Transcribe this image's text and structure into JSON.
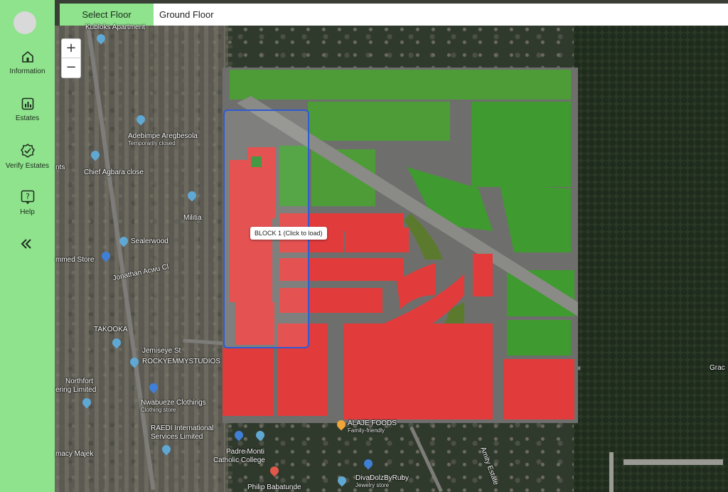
{
  "sidebar": {
    "items": [
      {
        "label": "Information",
        "icon": "home-icon"
      },
      {
        "label": "Estates",
        "icon": "chart-icon"
      },
      {
        "label": "Verify Estates",
        "icon": "verified-badge-icon"
      },
      {
        "label": "Help",
        "icon": "help-icon"
      }
    ],
    "collapse_icon": "double-chevron-left-icon"
  },
  "topbar": {
    "select_floor_label": "Select Floor",
    "floor_value": "Ground Floor"
  },
  "map": {
    "zoom_in": "+",
    "zoom_out": "−",
    "tooltip": "BLOCK 1 (Click to load)",
    "places": [
      {
        "name": "Kubloks Apartment",
        "sub": ""
      },
      {
        "name": "Adebimpe Aregbesola",
        "sub": "Temporarily closed"
      },
      {
        "name": "Chief Agbara close",
        "sub": ""
      },
      {
        "name": "Militia",
        "sub": ""
      },
      {
        "name": "Sealerwood",
        "sub": ""
      },
      {
        "name": "mmed Store",
        "sub": ""
      },
      {
        "name": "Jonathan Acwu Cl",
        "sub": ""
      },
      {
        "name": "TAKOOKA",
        "sub": ""
      },
      {
        "name": "Jemiseye St",
        "sub": ""
      },
      {
        "name": "ROCKYEMMYSTUDIOS",
        "sub": ""
      },
      {
        "name": "Northfort",
        "sub": ""
      },
      {
        "name": "ering Limited",
        "sub": ""
      },
      {
        "name": "Nwabueze Clothings",
        "sub": "Clothing store"
      },
      {
        "name": "RAEDI International",
        "sub": ""
      },
      {
        "name": "Services Limited",
        "sub": ""
      },
      {
        "name": "macy Majek",
        "sub": ""
      },
      {
        "name": "Padre Monti",
        "sub": ""
      },
      {
        "name": "Catholic College",
        "sub": ""
      },
      {
        "name": "ALAJE FOODS",
        "sub": "Family-friendly"
      },
      {
        "name": "DivaDolzByRuby",
        "sub": "Jewelry store"
      },
      {
        "name": "Philip Babatunde",
        "sub": ""
      },
      {
        "name": "Amity Estate",
        "sub": ""
      },
      {
        "name": "Grac",
        "sub": ""
      },
      {
        "name": "nts",
        "sub": ""
      }
    ]
  },
  "colors": {
    "sidebar": "#8fe38d",
    "plot_sold": "#e23b3b",
    "plot_available": "#3f9a2f",
    "block_outline": "#2e5bd6"
  }
}
